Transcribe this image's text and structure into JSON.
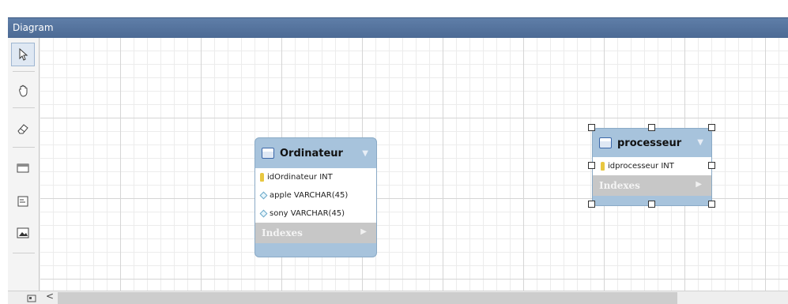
{
  "window": {
    "title": "Diagram"
  },
  "tools": [
    {
      "name": "pointer-tool",
      "icon": "pointer-icon",
      "selected": true
    },
    {
      "name": "hand-tool",
      "icon": "hand-icon"
    },
    {
      "name": "eraser-tool",
      "icon": "eraser-icon"
    },
    {
      "name": "layer-tool",
      "icon": "layer-icon"
    },
    {
      "name": "note-tool",
      "icon": "note-icon"
    },
    {
      "name": "image-tool",
      "icon": "image-icon"
    }
  ],
  "entities": {
    "ordinateur": {
      "name": "Ordinateur",
      "columns": [
        {
          "label": "idOrdinateur INT",
          "icon": "primary-key-icon"
        },
        {
          "label": "apple VARCHAR(45)",
          "icon": "column-icon"
        },
        {
          "label": "sony VARCHAR(45)",
          "icon": "column-icon"
        }
      ],
      "indexes_label": "Indexes"
    },
    "processeur": {
      "name": "processeur",
      "columns": [
        {
          "label": "idprocesseur INT",
          "icon": "primary-key-icon"
        }
      ],
      "indexes_label": "Indexes",
      "selected": true
    }
  },
  "scrollbar": {
    "left_arrow": "<"
  },
  "colors": {
    "titlebar": "#5a799f",
    "entity_header": "#a7c3dc",
    "indexes_bg": "#c7c7c7",
    "primary_key": "#e8c740"
  }
}
